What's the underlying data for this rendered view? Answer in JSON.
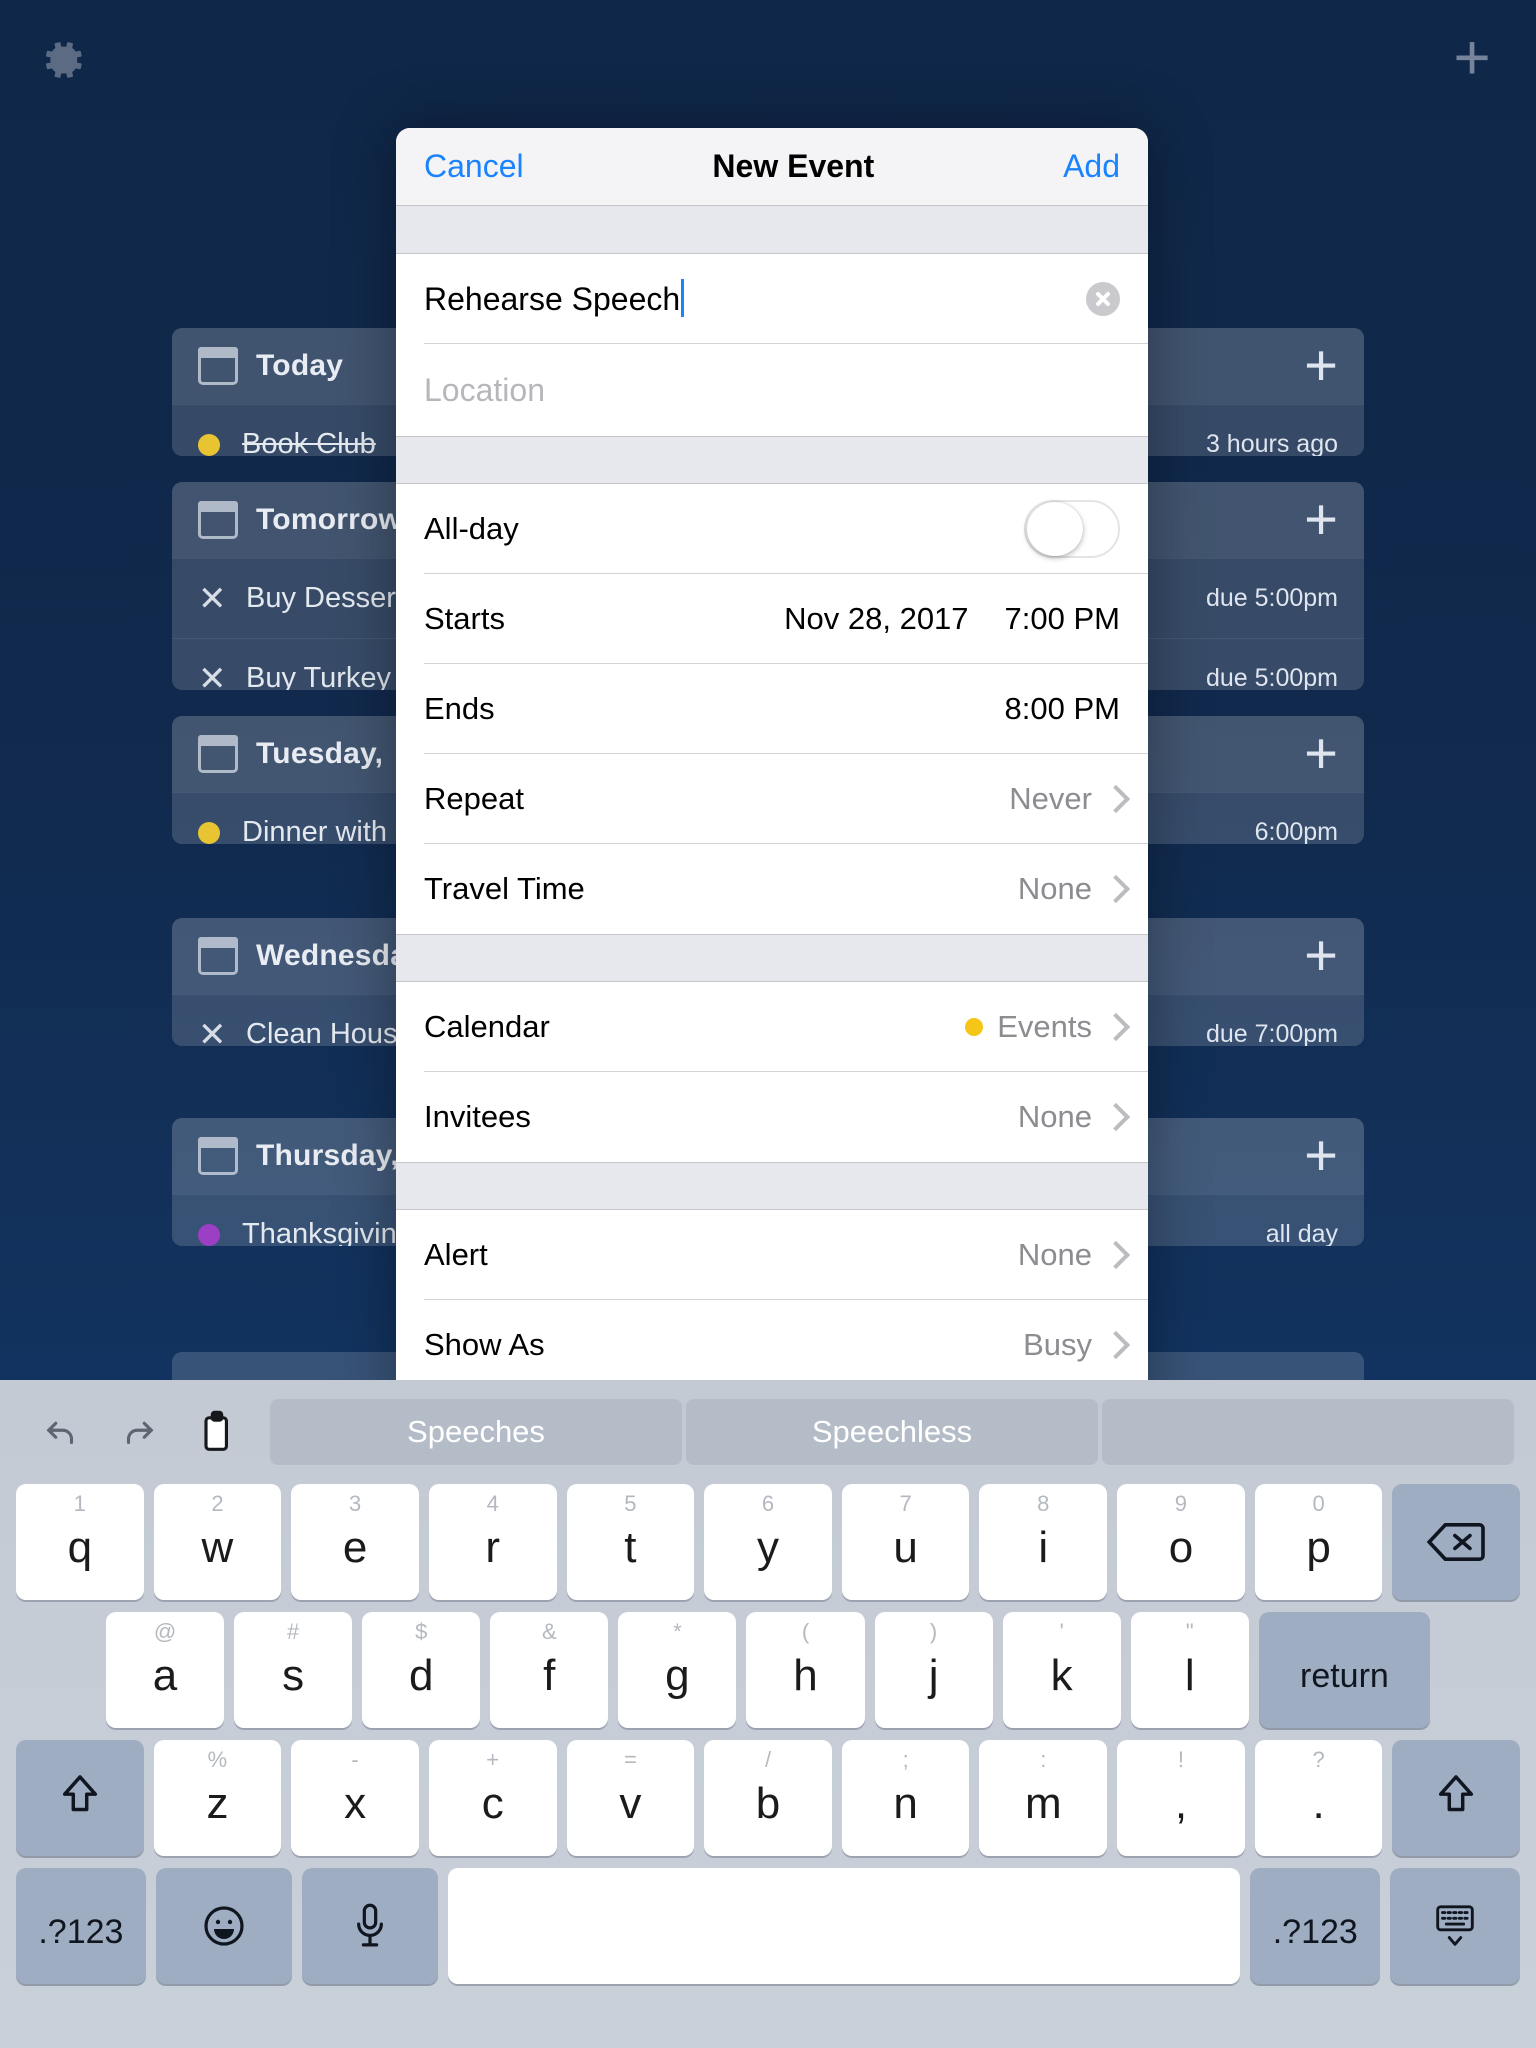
{
  "status_bar": {
    "gear_icon": "gear-icon",
    "add_icon": "plus-icon"
  },
  "background_app": {
    "cards": [
      {
        "title": "Today",
        "plus": "+",
        "items": [
          {
            "marker": "dot",
            "dot_color": "#e8c432",
            "text": "Book Club",
            "completed": true,
            "meta": "3 hours ago"
          }
        ]
      },
      {
        "title": "Tomorrow",
        "plus": "+",
        "items": [
          {
            "marker": "x",
            "text": "Buy Dessert",
            "completed": false,
            "meta": "due 5:00pm"
          },
          {
            "marker": "x",
            "text": "Buy Turkey",
            "completed": false,
            "meta": "due 5:00pm"
          }
        ]
      },
      {
        "title": "Tuesday,",
        "plus": "+",
        "items": [
          {
            "marker": "dot",
            "dot_color": "#e8c432",
            "text": "Dinner with",
            "completed": false,
            "meta": "6:00pm"
          }
        ]
      },
      {
        "title": "Wednesday",
        "plus": "+",
        "items": [
          {
            "marker": "x",
            "text": "Clean House",
            "completed": false,
            "meta": "due 7:00pm"
          }
        ]
      },
      {
        "title": "Thursday,",
        "plus": "+",
        "items": [
          {
            "marker": "dot",
            "dot_color": "#9b3fc4",
            "text": "Thanksgiving",
            "completed": false,
            "meta": "all day"
          }
        ]
      }
    ]
  },
  "modal": {
    "cancel_label": "Cancel",
    "title": "New Event",
    "add_label": "Add",
    "title_field": {
      "value": "Rehearse Speech",
      "clear_icon": "clear-icon"
    },
    "location_field": {
      "value": "",
      "placeholder": "Location"
    },
    "rows": [
      {
        "label": "All-day",
        "control": "toggle",
        "on": false
      },
      {
        "label": "Starts",
        "value": "Nov 28, 2017",
        "value2": "7:00 PM",
        "control": "datetime"
      },
      {
        "label": "Ends",
        "value": "",
        "value2": "8:00 PM",
        "control": "datetime"
      },
      {
        "label": "Repeat",
        "value": "Never",
        "control": "chevron"
      },
      {
        "label": "Travel Time",
        "value": "None",
        "control": "chevron"
      },
      {
        "label": "Calendar",
        "value": "Events",
        "dot": "#f5c518",
        "control": "chevron"
      },
      {
        "label": "Invitees",
        "value": "None",
        "control": "chevron"
      },
      {
        "label": "Alert",
        "value": "None",
        "control": "chevron"
      },
      {
        "label": "Show As",
        "value": "Busy",
        "control": "chevron"
      }
    ],
    "accent_color": "#1a84ff"
  },
  "keyboard": {
    "tools": [
      {
        "name": "undo-icon"
      },
      {
        "name": "redo-icon"
      },
      {
        "name": "paste-icon"
      }
    ],
    "predictions": [
      "Speeches",
      "Speechless",
      ""
    ],
    "row1": [
      {
        "main": "q",
        "alt": "1"
      },
      {
        "main": "w",
        "alt": "2"
      },
      {
        "main": "e",
        "alt": "3"
      },
      {
        "main": "r",
        "alt": "4"
      },
      {
        "main": "t",
        "alt": "5"
      },
      {
        "main": "y",
        "alt": "6"
      },
      {
        "main": "u",
        "alt": "7"
      },
      {
        "main": "i",
        "alt": "8"
      },
      {
        "main": "o",
        "alt": "9"
      },
      {
        "main": "p",
        "alt": "0"
      }
    ],
    "backspace_icon": "backspace-icon",
    "row2": [
      {
        "main": "a",
        "alt": "@"
      },
      {
        "main": "s",
        "alt": "#"
      },
      {
        "main": "d",
        "alt": "$"
      },
      {
        "main": "f",
        "alt": "&"
      },
      {
        "main": "g",
        "alt": "*"
      },
      {
        "main": "h",
        "alt": "("
      },
      {
        "main": "j",
        "alt": ")"
      },
      {
        "main": "k",
        "alt": "'"
      },
      {
        "main": "l",
        "alt": "\""
      }
    ],
    "return_label": "return",
    "row3": [
      {
        "main": "z",
        "alt": "%"
      },
      {
        "main": "x",
        "alt": "-"
      },
      {
        "main": "c",
        "alt": "+"
      },
      {
        "main": "v",
        "alt": "="
      },
      {
        "main": "b",
        "alt": "/"
      },
      {
        "main": "n",
        "alt": ";"
      },
      {
        "main": "m",
        "alt": ":"
      },
      {
        "main": ",",
        "alt": "!"
      },
      {
        "main": ".",
        "alt": "?"
      }
    ],
    "shift_icon": "shift-icon",
    "numeric_label": ".?123",
    "emoji_icon": "emoji-icon",
    "mic_icon": "microphone-icon",
    "space_label": "",
    "dismiss_icon": "hide-keyboard-icon"
  }
}
